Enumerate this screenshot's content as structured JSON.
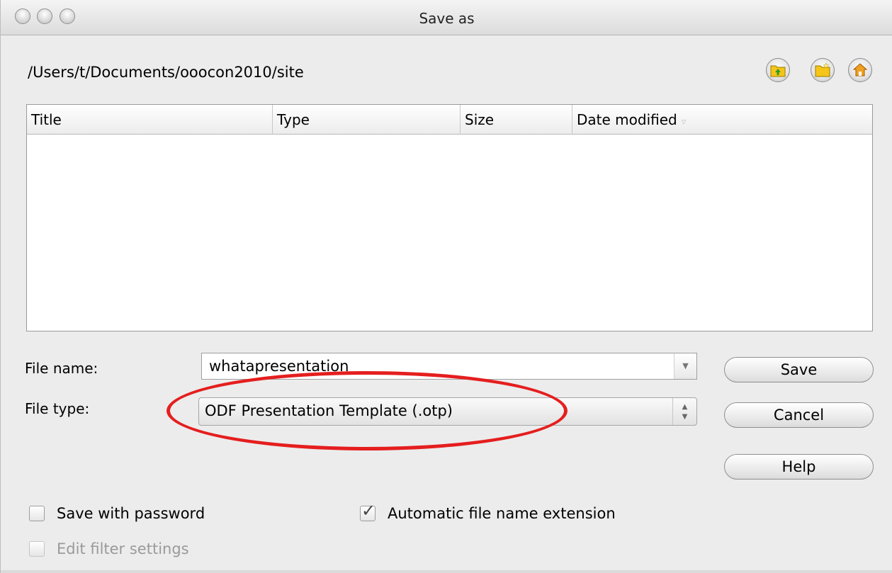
{
  "window": {
    "title": "Save as"
  },
  "path": "/Users/t/Documents/ooocon2010/site",
  "toolbar": {
    "up_icon": "folder-up-icon",
    "new_folder_icon": "new-folder-icon",
    "home_icon": "home-icon"
  },
  "filelist": {
    "columns": [
      "Title",
      "Type",
      "Size",
      "Date modified"
    ],
    "sort_indicator": "▿",
    "rows": []
  },
  "form": {
    "file_name_label": "File name:",
    "file_name_value": "whatapresentation",
    "file_type_label": "File type:",
    "file_type_value": "ODF Presentation Template (.otp)"
  },
  "buttons": {
    "save": "Save",
    "cancel": "Cancel",
    "help": "Help"
  },
  "options": {
    "save_with_password": {
      "label": "Save with password",
      "checked": false
    },
    "auto_extension": {
      "label": "Automatic file name extension",
      "checked": true
    },
    "edit_filter": {
      "label": "Edit filter settings",
      "checked": false,
      "enabled": false
    }
  },
  "colors": {
    "annotation": "#e51e1e",
    "window_bg": "#ececec"
  }
}
